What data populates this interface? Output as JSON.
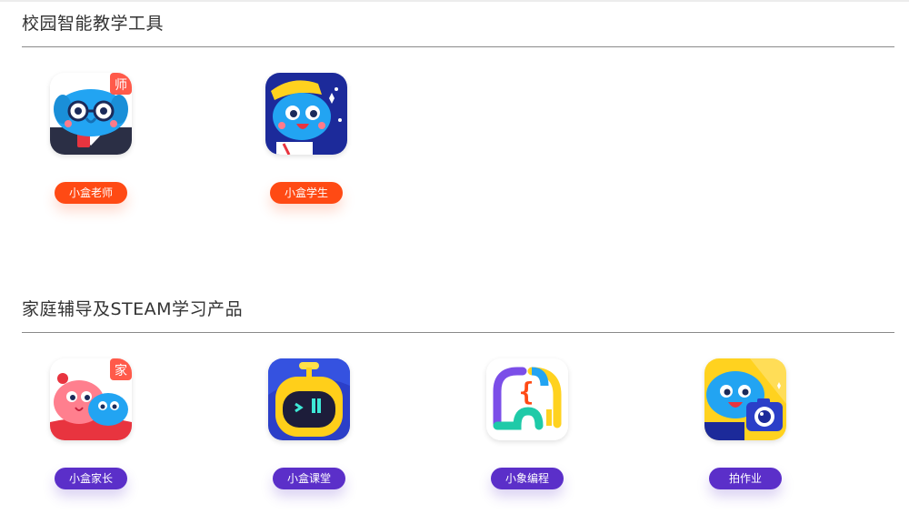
{
  "sections": [
    {
      "title": "校园智能教学工具",
      "apps": [
        {
          "label": "小盒老师",
          "icon": "teacher-app-icon",
          "badge": "师"
        },
        {
          "label": "小盒学生",
          "icon": "student-app-icon"
        }
      ]
    },
    {
      "title": "家庭辅导及STEAM学习产品",
      "apps": [
        {
          "label": "小盒家长",
          "icon": "parent-app-icon",
          "badge": "家"
        },
        {
          "label": "小盒课堂",
          "icon": "robot-classroom-app-icon"
        },
        {
          "label": "小象编程",
          "icon": "elephant-coding-app-icon"
        },
        {
          "label": "拍作业",
          "icon": "camera-homework-app-icon"
        }
      ]
    }
  ],
  "colors": {
    "pill_red": "#ff4a14",
    "pill_purple": "#5b2fc9",
    "brand_blue": "#1e9bf0"
  }
}
